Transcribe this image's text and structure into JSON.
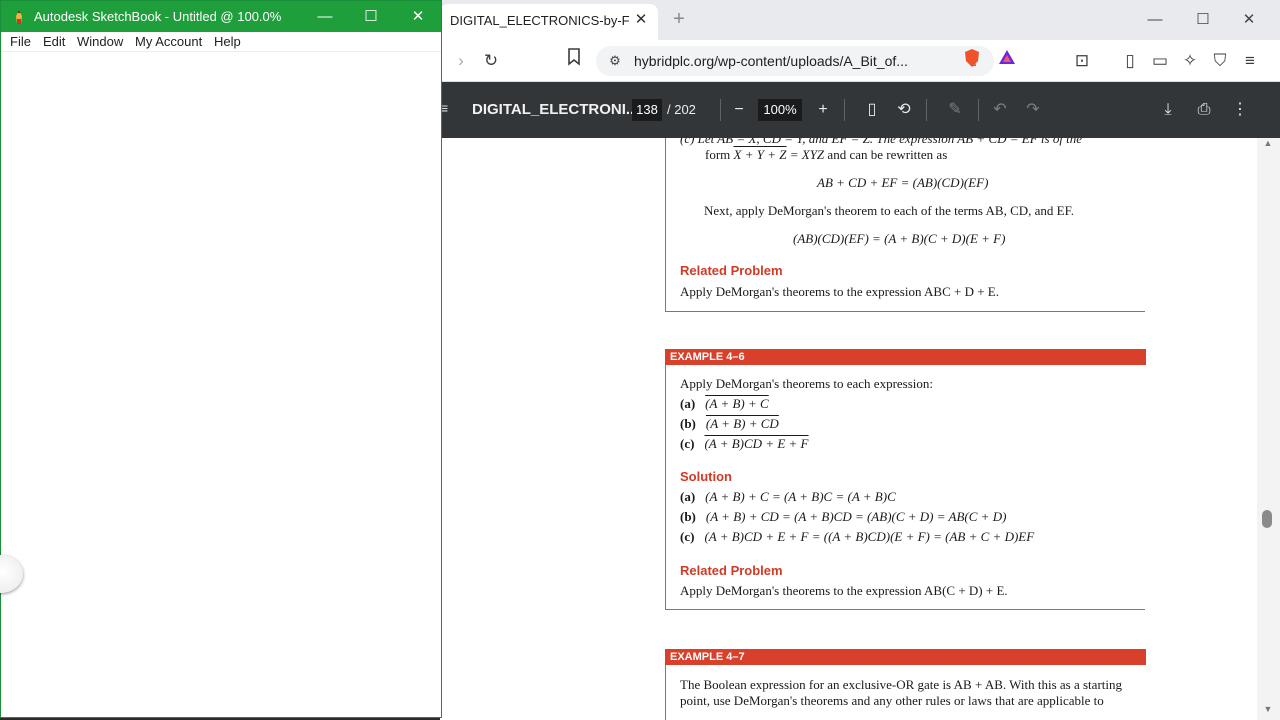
{
  "browser": {
    "tab_title": "DIGITAL_ELECTRONICS-by-Flyod",
    "url": "hybridplc.org/wp-content/uploads/A_Bit_of...",
    "pdf": {
      "title": "DIGITAL_ELECTRONI...",
      "page_current": "138",
      "page_total": "/ 202",
      "zoom": "100%"
    }
  },
  "document": {
    "top_line_a": "(c)  Let AB = X, CD = Y, and EF = Z. The expression AB + CD = EF is of the",
    "top_line_b_pre": "form",
    "top_line_b_eq1": "X + Y + Z",
    "top_line_b_eq2": "= XYZ",
    "top_line_b_post": "and can be rewritten as",
    "rewrite_eq": "AB + CD + EF = (AB)(CD)(EF)",
    "demorgan_line": "Next, apply DeMorgan's theorem to each of the terms AB, CD, and EF.",
    "demorgan_eq": "(AB)(CD)(EF) = (A + B)(C + D)(E + F)",
    "related_problem_label": "Related Problem",
    "related_1": "Apply DeMorgan's theorems to the expression ABC + D + E.",
    "example_6_header": "EXAMPLE 4–6",
    "example_6_intro": "Apply DeMorgan's theorems to each expression:",
    "ex6_parts": [
      {
        "label": "(a)",
        "expr": "(A + B) + C"
      },
      {
        "label": "(b)",
        "expr": "(A + B) + CD"
      },
      {
        "label": "(c)",
        "expr": "(A + B)CD + E + F"
      }
    ],
    "solution_label": "Solution",
    "solutions": [
      {
        "label": "(a)",
        "expr": "(A + B) + C = (A + B)C = (A + B)C"
      },
      {
        "label": "(b)",
        "expr": "(A + B) + CD = (A + B)CD = (AB)(C + D) = AB(C + D)"
      },
      {
        "label": "(c)",
        "expr": "(A + B)CD + E + F = ((A + B)CD)(E + F) = (AB + C + D)EF"
      }
    ],
    "related_2": "Apply DeMorgan's theorems to the expression AB(C + D) + E.",
    "example_7_header": "EXAMPLE 4–7",
    "example_7_line1": "The Boolean expression for an exclusive-OR gate is AB + AB. With this as a starting",
    "example_7_line2": "point, use DeMorgan's theorems and any other rules or laws that are applicable to"
  },
  "sketchbook": {
    "title": "Autodesk SketchBook - Untitled @ 100.0%",
    "menu": [
      "File",
      "Edit",
      "Window",
      "My Account",
      "Help"
    ]
  },
  "colors": {
    "sketch_titlebar": "#1e9f3c",
    "pdf_toolbar": "#323639",
    "example_header": "#d9402b",
    "related_problem": "#d03a26"
  }
}
